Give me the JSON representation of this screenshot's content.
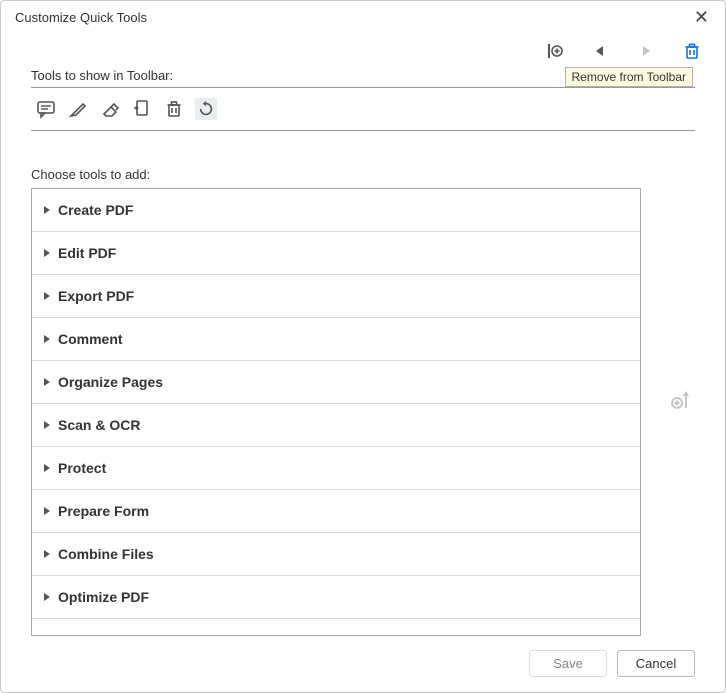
{
  "dialog": {
    "title": "Customize Quick Tools"
  },
  "labels": {
    "tools_to_show": "Tools to show in Toolbar:",
    "choose_tools": "Choose tools to add:"
  },
  "tooltip": {
    "remove": "Remove from Toolbar"
  },
  "toolbar_tools": [
    {
      "name": "comment-bubble-icon"
    },
    {
      "name": "highlight-pen-icon"
    },
    {
      "name": "eraser-icon"
    },
    {
      "name": "page-arrow-icon"
    },
    {
      "name": "trash-icon"
    },
    {
      "name": "rotate-icon",
      "selected": true
    }
  ],
  "top_controls": {
    "add_divider": {
      "icon": "divider-add-icon"
    },
    "move_left": {
      "icon": "triangle-left-icon",
      "enabled": true
    },
    "move_right": {
      "icon": "triangle-right-icon",
      "enabled": false
    },
    "remove": {
      "icon": "trash-icon",
      "accent": "#1473e6"
    }
  },
  "categories": [
    {
      "label": "Create PDF"
    },
    {
      "label": "Edit PDF"
    },
    {
      "label": "Export PDF"
    },
    {
      "label": "Comment"
    },
    {
      "label": "Organize Pages"
    },
    {
      "label": "Scan & OCR"
    },
    {
      "label": "Protect"
    },
    {
      "label": "Prepare Form"
    },
    {
      "label": "Combine Files"
    },
    {
      "label": "Optimize PDF"
    }
  ],
  "side": {
    "add_up_icon": "add-move-up-icon"
  },
  "buttons": {
    "save": "Save",
    "cancel": "Cancel"
  },
  "colors": {
    "accent": "#1473e6",
    "icon": "#555"
  }
}
